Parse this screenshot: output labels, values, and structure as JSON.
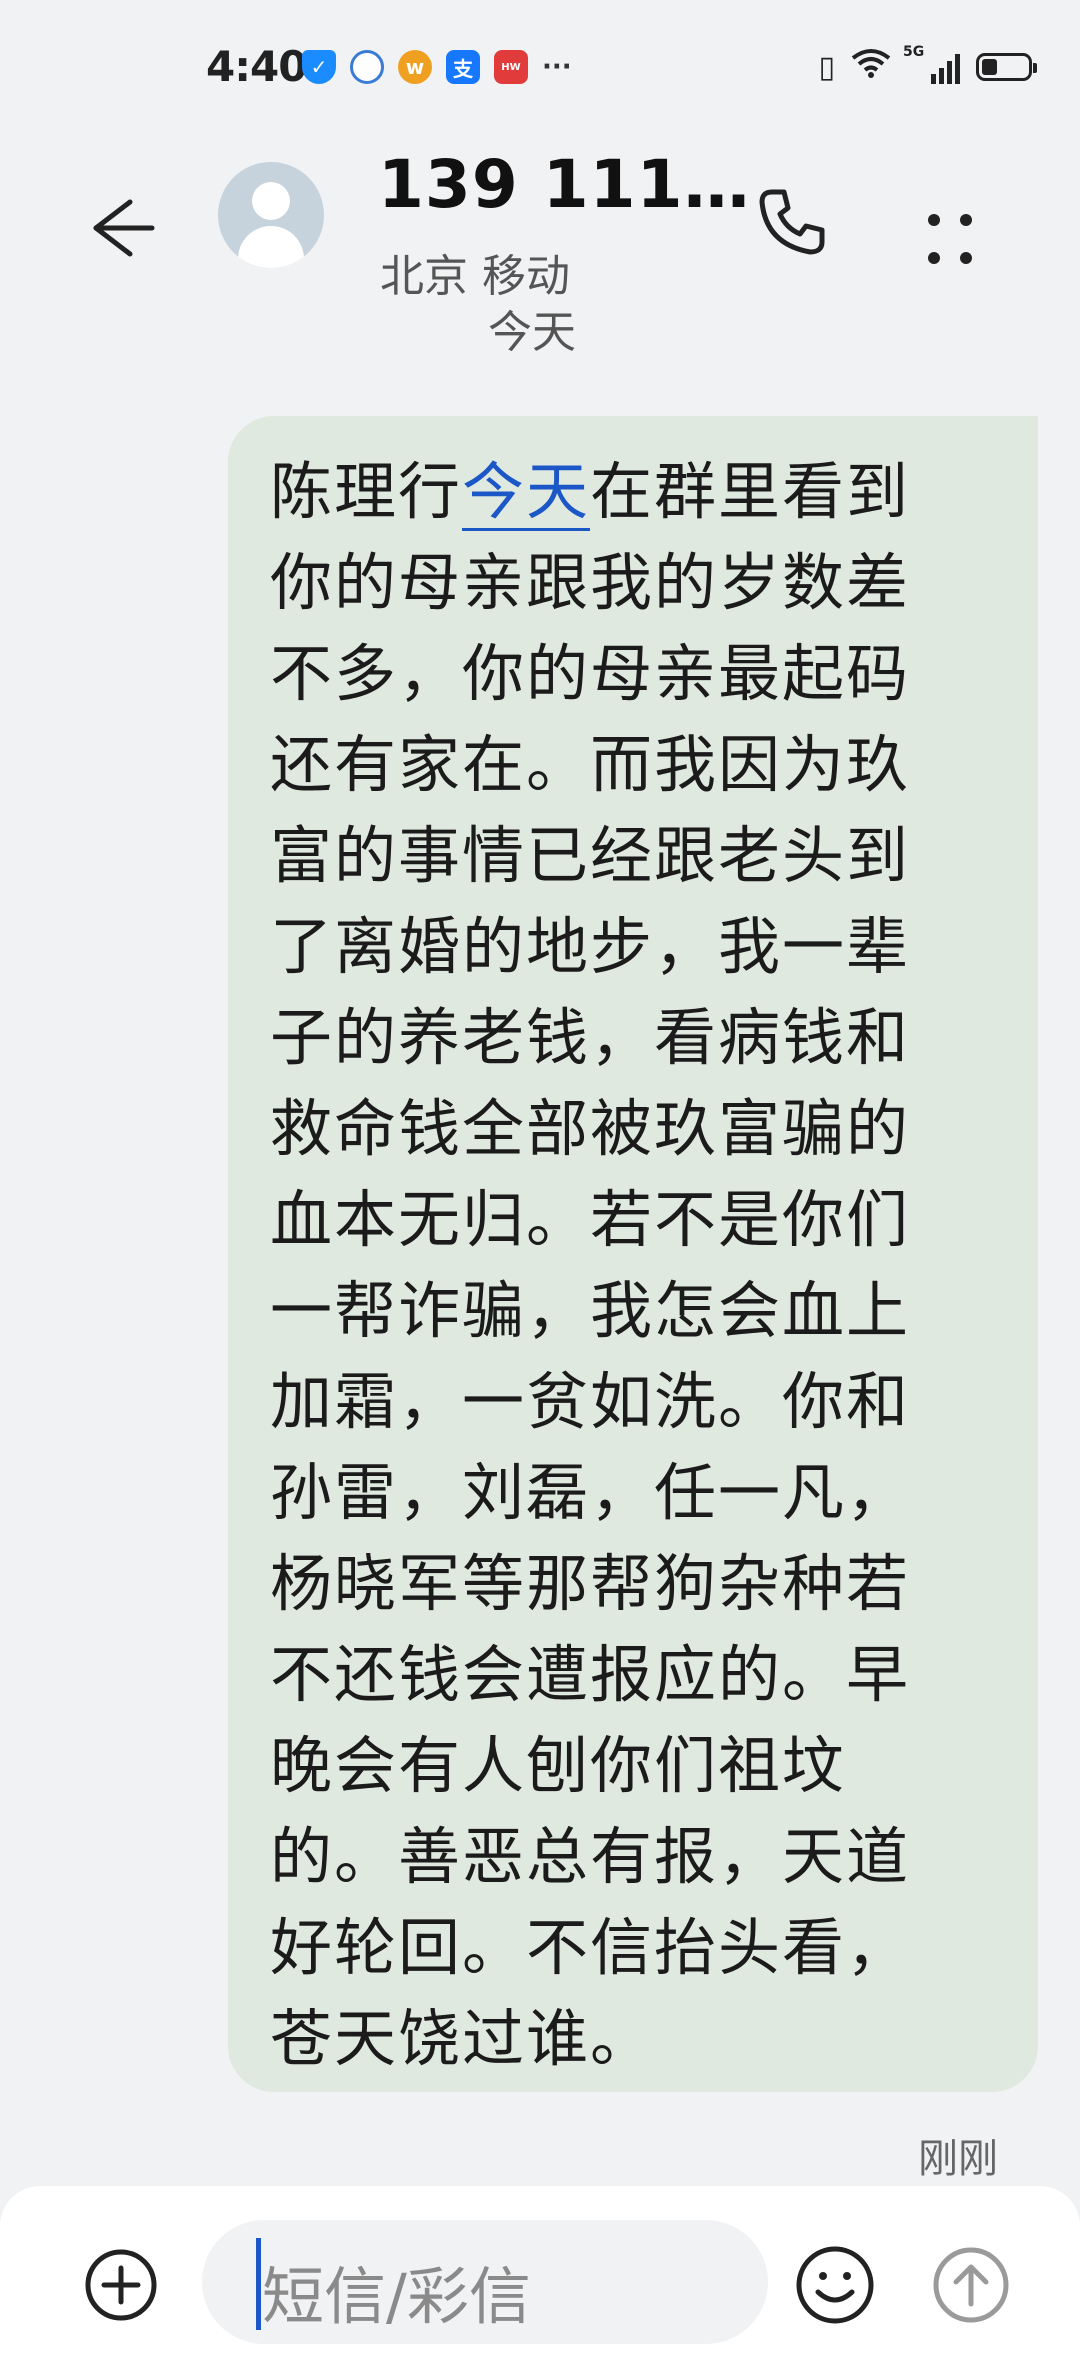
{
  "status_bar": {
    "time": "4:40",
    "network": "5G",
    "battery_level": 0.35,
    "notification_icons": [
      "shield-icon",
      "browser-icon",
      "weibo-icon",
      "alipay-icon",
      "huawei-icon"
    ],
    "more": "···"
  },
  "header": {
    "contact_name": "139 111…",
    "contact_location": "北京 移动",
    "date_label": "今天"
  },
  "message": {
    "before_link": "陈理行",
    "link_text": "今天",
    "after_link": "在群里看到\n你的母亲跟我的岁数差\n不多，你的母亲最起码\n还有家在。而我因为玖\n富的事情已经跟老头到\n了离婚的地步，我一辈\n子的养老钱，看病钱和\n救命钱全部被玖富骗的\n血本无归。若不是你们\n一帮诈骗，我怎会血上\n加霜，一贫如洗。你和\n孙雷，刘磊，任一凡，\n杨晓军等那帮狗杂种若\n不还钱会遭报应的。早\n晚会有人刨你们祖坟\n的。善恶总有报，天道\n好轮回。不信抬头看，\n苍天饶过谁。",
    "timestamp": "刚刚"
  },
  "input": {
    "placeholder": "短信/彩信"
  },
  "colors": {
    "bubble": "#dfe9df",
    "link": "#1c57c8",
    "background": "#f1f2f4"
  }
}
